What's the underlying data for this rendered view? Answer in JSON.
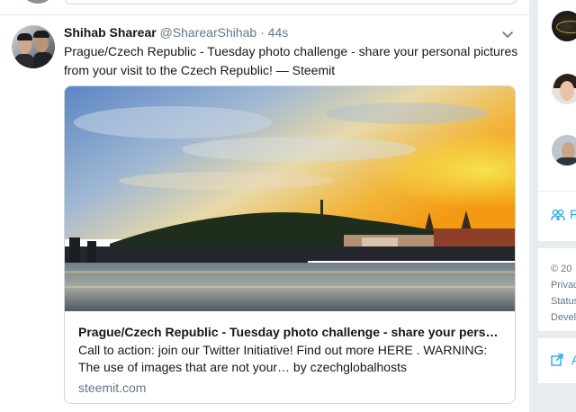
{
  "tweet": {
    "author_name": "Shihab Sharear",
    "author_handle": "@SharearShihab",
    "separator": "·",
    "timestamp": "44s",
    "text": "Prague/Czech Republic - Tuesday photo challenge - share your personal pictures from your visit to the Czech Republic! — Steemit",
    "card": {
      "title": "Prague/Czech Republic - Tuesday photo challenge - share your perso...",
      "description": "Call to action: join our Twitter Initiative! Find out more HERE . WARNING: The use of images that are not your… by czechglobalhosts",
      "domain": "steemit.com"
    }
  },
  "sidebar": {
    "people_label": "F",
    "footer_lines": [
      "© 20",
      "Privac",
      "Status",
      "Devel"
    ],
    "ad_label": "A"
  },
  "icons": {
    "tweet_menu": "chevron-down-icon",
    "people": "people-icon",
    "ad": "external-link-icon"
  },
  "colors": {
    "accent": "#1da1f2",
    "secondary_text": "#657786",
    "primary_text": "#14171a",
    "border": "#ccd6dd",
    "background": "#e6ecf0"
  }
}
